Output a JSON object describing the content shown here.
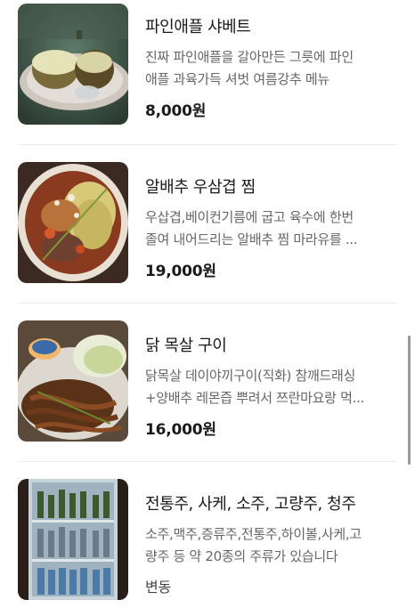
{
  "menu": {
    "items": [
      {
        "name": "파인애플 샤베트",
        "desc_lines": [
          "진짜 파인애플을 갈아만든 그릇에 파인",
          "애플 과육가득 셔벗 여름강추 메뉴"
        ],
        "price": "8,000원",
        "image": "pineapple-sherbet-photo"
      },
      {
        "name": "알배추 우삼겹 찜",
        "desc_lines": [
          "우삽겹,베이컨기름에 굽고 육수에 한번",
          "졸여 내어드리는 알배추 찜 마라유를 ..."
        ],
        "price": "19,000원",
        "image": "napa-cabbage-beef-photo"
      },
      {
        "name": "닭 목살 구이",
        "desc_lines": [
          "닭목살 데이야끼구이(직화) 참깨드래싱",
          "+양배추 레몬즙 뿌려서 쯔란마요랑 먹..."
        ],
        "price": "16,000원",
        "image": "grilled-chicken-neck-photo"
      },
      {
        "name": "전통주, 사케, 소주, 고량주, 청주",
        "desc_lines": [
          "소주,맥주,증류주,전통주,하이볼,사케,고",
          "량주 등 약 20종의 주류가 있습니다"
        ],
        "price": "변동",
        "image": "liquor-fridge-photo"
      }
    ]
  }
}
